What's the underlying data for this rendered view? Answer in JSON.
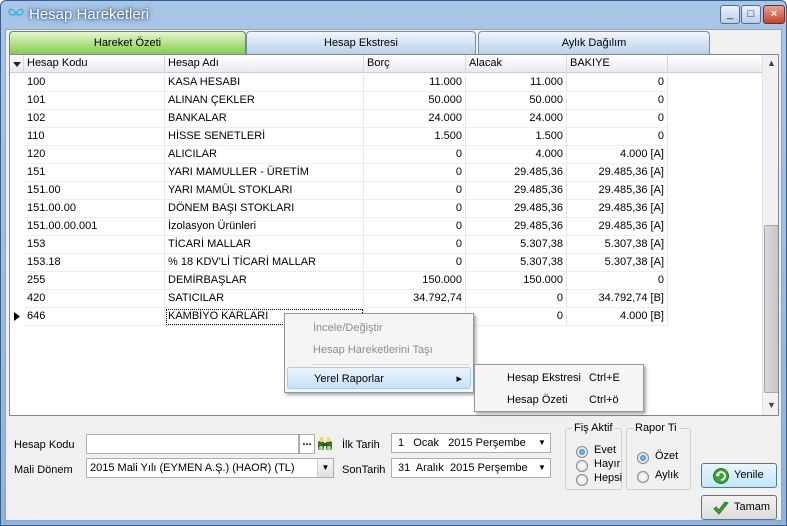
{
  "window": {
    "title": "Hesap Hareketleri"
  },
  "titlebar": {
    "min": "_",
    "max": "□",
    "close": "×"
  },
  "tabs": [
    {
      "label": "Hareket Özeti",
      "active": true
    },
    {
      "label": "Hesap Ekstresi",
      "active": false
    },
    {
      "label": "Aylık Dağılım",
      "active": false
    }
  ],
  "grid": {
    "columns": [
      "Hesap Kodu",
      "Hesap Adı",
      "Borç",
      "Alacak",
      "BAKIYE"
    ],
    "rows": [
      [
        "100",
        "KASA HESABI",
        "11.000",
        "11.000",
        "0"
      ],
      [
        "101",
        "ALINAN ÇEKLER",
        "50.000",
        "50.000",
        "0"
      ],
      [
        "102",
        "BANKALAR",
        "24.000",
        "24.000",
        "0"
      ],
      [
        "110",
        "HİSSE SENETLERİ",
        "1.500",
        "1.500",
        "0"
      ],
      [
        "120",
        "ALICILAR",
        "0",
        "4.000",
        "4.000 [A]"
      ],
      [
        "151",
        "YARI MAMULLER - ÜRETİM",
        "0",
        "29.485,36",
        "29.485,36 [A]"
      ],
      [
        "151.00",
        "YARI MAMÜL STOKLARI",
        "0",
        "29.485,36",
        "29.485,36 [A]"
      ],
      [
        "151.00.00",
        "DÖNEM BAŞI STOKLARI",
        "0",
        "29.485,36",
        "29.485,36 [A]"
      ],
      [
        "151.00.00.001",
        "İzolasyon Ürünleri",
        "0",
        "29.485,36",
        "29.485,36 [A]"
      ],
      [
        "153",
        "TİCARİ MALLAR",
        "0",
        "5.307,38",
        "5.307,38 [A]"
      ],
      [
        "153.18",
        "% 18 KDV'Lİ TİCARİ MALLAR",
        "0",
        "5.307,38",
        "5.307,38 [A]"
      ],
      [
        "255",
        "DEMİRBAŞLAR",
        "150.000",
        "150.000",
        "0"
      ],
      [
        "420",
        "SATICILAR",
        "34.792,74",
        "0",
        "34.792,74 [B]"
      ],
      [
        "646",
        "KAMBİYO KARLARI",
        "",
        "0",
        "4.000 [B]"
      ]
    ]
  },
  "context_menu": {
    "items": [
      "İncele/Değiştir",
      "Hesap Hareketlerini Taşı",
      "Yerel Raporlar"
    ],
    "submenu_arrow": "▸"
  },
  "submenu": {
    "items": [
      {
        "label": "Hesap Ekstresi",
        "shortcut": "Ctrl+E"
      },
      {
        "label": "Hesap Özeti",
        "shortcut": "Ctrl+ö"
      }
    ]
  },
  "filters": {
    "hesap_kodu_label": "Hesap Kodu",
    "hesap_kodu_value": "",
    "browse": "...",
    "mali_donem_label": "Mali Dönem",
    "mali_donem_value": "2015 Mali Yılı (EYMEN A.Ş.) (HAOR) (TL)",
    "ilk_tarih_label": "İlk Tarih",
    "ilk_tarih_value": "1   Ocak   2015 Perşembe",
    "son_tarih_label": "SonTarih",
    "son_tarih_value": "31  Aralık  2015 Perşembe"
  },
  "fis_aktif": {
    "title": "Fiş Aktif",
    "options": [
      "Evet",
      "Hayır",
      "Hepsi"
    ],
    "selected": 0
  },
  "rapor_tipi": {
    "title": "Rapor Ti",
    "options": [
      "Özet",
      "Aylık"
    ],
    "selected": 0
  },
  "buttons": {
    "yenile": "Yenile",
    "tamam": "Tamam"
  }
}
